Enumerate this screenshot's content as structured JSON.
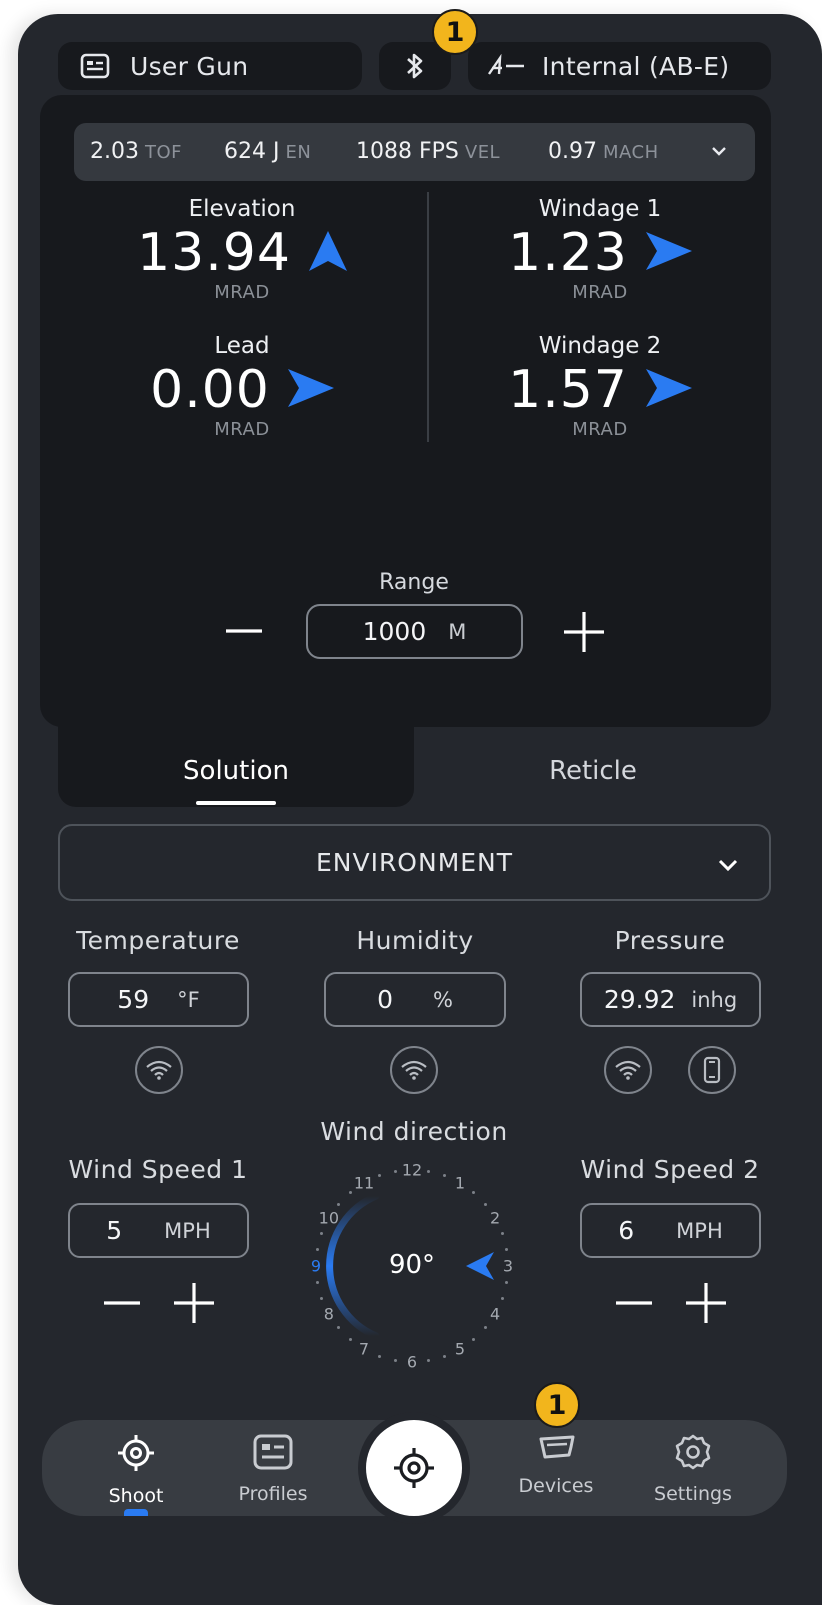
{
  "header": {
    "gun_label": "User Gun",
    "bluetooth_icon": "bluetooth-icon",
    "source_label": "Internal (AB-E)",
    "badge_top": "1"
  },
  "stats": {
    "tof_value": "2.03",
    "tof_unit": "TOF",
    "energy_value": "624 J",
    "energy_unit": "EN",
    "velocity_value": "1088 FPS",
    "velocity_unit": "VEL",
    "mach_value": "0.97",
    "mach_unit": "MACH"
  },
  "solution": {
    "elevation": {
      "label": "Elevation",
      "value": "13.94",
      "unit": "MRAD"
    },
    "windage1": {
      "label": "Windage 1",
      "value": "1.23",
      "unit": "MRAD"
    },
    "lead": {
      "label": "Lead",
      "value": "0.00",
      "unit": "MRAD"
    },
    "windage2": {
      "label": "Windage 2",
      "value": "1.57",
      "unit": "MRAD"
    }
  },
  "range": {
    "label": "Range",
    "value": "1000",
    "unit": "M"
  },
  "tabs": {
    "solution": "Solution",
    "reticle": "Reticle"
  },
  "environment": {
    "title": "ENVIRONMENT",
    "temperature": {
      "label": "Temperature",
      "value": "59",
      "unit": "°F"
    },
    "humidity": {
      "label": "Humidity",
      "value": "0",
      "unit": "%"
    },
    "pressure": {
      "label": "Pressure",
      "value": "29.92",
      "unit": "inhg"
    }
  },
  "wind": {
    "direction_label": "Wind direction",
    "direction_value": "90°",
    "speed1": {
      "label": "Wind Speed 1",
      "value": "5",
      "unit": "MPH"
    },
    "speed2": {
      "label": "Wind Speed 2",
      "value": "6",
      "unit": "MPH"
    },
    "dial_numbers": [
      "12",
      "1",
      "2",
      "3",
      "4",
      "5",
      "6",
      "7",
      "8",
      "9",
      "10",
      "11"
    ]
  },
  "nav": {
    "shoot": "Shoot",
    "profiles": "Profiles",
    "devices": "Devices",
    "settings": "Settings",
    "badge_devices": "1"
  },
  "colors": {
    "accent": "#2a7bf2",
    "background": "#24272d",
    "panel": "#17191d",
    "badge": "#f2b51c"
  }
}
